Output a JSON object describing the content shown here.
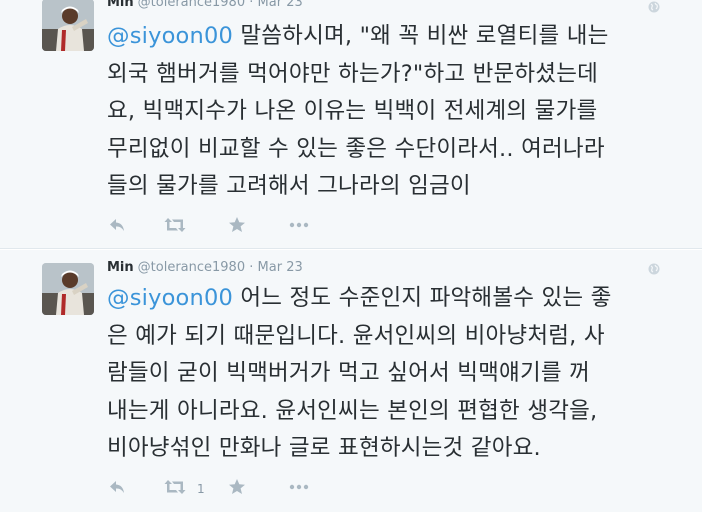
{
  "tweets": [
    {
      "author_name": "Min",
      "handle": "@tolerance1980",
      "separator": "·",
      "date": "Mar 23",
      "mention": "@siyoon00",
      "lines": [
        " 말씀하시며, \"왜 꼭 비싼 로열티를 내는",
        "외국 햄버거를 먹어야만 하는가?\"하고 반문하셨는데",
        "요,  빅맥지수가 나온 이유는 빅백이 전세계의 물가를",
        "무리없이 비교할 수 있는 좋은 수단이라서.. 여러나라",
        "들의 물가를 고려해서 그나라의 임금이"
      ],
      "retweet_count": "",
      "icons": {
        "avatar": "avatar-photo",
        "globe": "globe-icon",
        "reply": "reply-icon",
        "retweet": "retweet-icon",
        "favorite": "star-icon",
        "more": "more-dots-icon"
      }
    },
    {
      "author_name": "Min",
      "handle": "@tolerance1980",
      "separator": "·",
      "date": "Mar 23",
      "mention": "@siyoon00",
      "lines": [
        " 어느 정도 수준인지 파악해볼수 있는 좋",
        "은 예가 되기 때문입니다. 윤서인씨의 비아냥처럼, 사",
        "람들이 굳이 빅맥버거가 먹고 싶어서 빅맥얘기를 꺼",
        "내는게 아니라요. 윤서인씨는 본인의 편협한 생각을,",
        "비아냥섞인 만화나 글로 표현하시는것 같아요."
      ],
      "retweet_count": "1",
      "icons": {
        "avatar": "avatar-photo",
        "globe": "globe-icon",
        "reply": "reply-icon",
        "retweet": "retweet-icon",
        "favorite": "star-icon",
        "more": "more-dots-icon"
      }
    }
  ],
  "colors": {
    "background": "#f5f8fa",
    "text": "#292f33",
    "meta": "#8899a6",
    "mention": "#3b94d9",
    "action_icon": "#aab8c2"
  }
}
